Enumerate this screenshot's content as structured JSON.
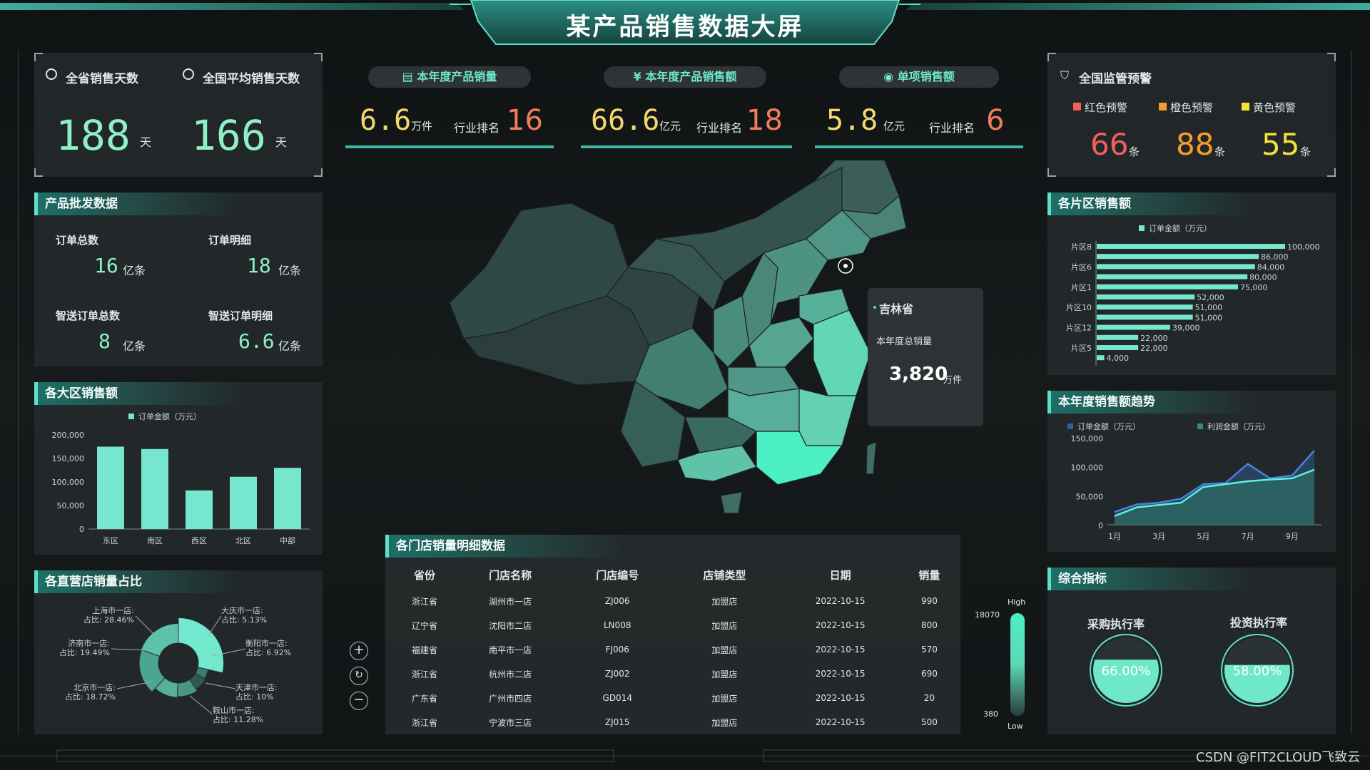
{
  "title": "某产品销售数据大屏",
  "days": {
    "province_label": "全省销售天数",
    "province_value": "188",
    "province_unit": "天",
    "national_label": "全国平均销售天数",
    "national_value": "166",
    "national_unit": "天"
  },
  "kpis": [
    {
      "label": "本年度产品销量",
      "value": "6.6",
      "unit": "万件",
      "rank_label": "行业排名",
      "rank": "16"
    },
    {
      "label": "本年度产品销售额",
      "value": "66.6",
      "unit": "亿元",
      "rank_label": "行业排名",
      "rank": "18"
    },
    {
      "label": "单项销售额",
      "value": "5.8",
      "unit": "亿元",
      "rank_label": "行业排名",
      "rank": "6"
    }
  ],
  "alerts": {
    "title": "全国监管预警",
    "items": [
      {
        "label": "红色预警",
        "value": "66",
        "unit": "条",
        "color": "#f0615c"
      },
      {
        "label": "橙色预警",
        "value": "88",
        "unit": "条",
        "color": "#f79b2c"
      },
      {
        "label": "黄色预警",
        "value": "55",
        "unit": "条",
        "color": "#f5e03c"
      }
    ]
  },
  "wholesale": {
    "title": "产品批发数据",
    "items": [
      {
        "label": "订单总数",
        "value": "16",
        "unit": "亿条"
      },
      {
        "label": "订单明细",
        "value": "18",
        "unit": "亿条"
      },
      {
        "label": "智送订单总数",
        "value": "8",
        "unit": "亿条"
      },
      {
        "label": "智送订单明细",
        "value": "6.6",
        "unit": "亿条"
      }
    ]
  },
  "region_chart": {
    "title": "各大区销售额",
    "legend": "订单金额（万元）",
    "y_ticks": [
      "200,000",
      "150,000",
      "100,000",
      "50,000",
      "0"
    ]
  },
  "store_share": {
    "title": "各直营店销量占比",
    "labels": [
      {
        "name": "上海市一店:",
        "share": "占比: 28.46%"
      },
      {
        "name": "大庆市一店:",
        "share": "占比: 5.13%"
      },
      {
        "name": "济南市一店:",
        "share": "占比: 19.49%"
      },
      {
        "name": "衡阳市一店:",
        "share": "占比: 6.92%"
      },
      {
        "name": "北京市一店:",
        "share": "占比: 18.72%"
      },
      {
        "name": "天津市一店:",
        "share": "占比: 10%"
      },
      {
        "name": "鞍山市一店:",
        "share": "占比: 11.28%"
      }
    ]
  },
  "map": {
    "tooltip_province": "吉林省",
    "tooltip_label": "本年度总销量",
    "tooltip_value": "3,820",
    "tooltip_unit": "万件",
    "legend_high": "High",
    "legend_low": "Low",
    "legend_max": "18070",
    "legend_min": "380"
  },
  "table": {
    "title": "各门店销量明细数据",
    "headers": [
      "省份",
      "门店名称",
      "门店编号",
      "店铺类型",
      "日期",
      "销量"
    ],
    "rows": [
      [
        "浙江省",
        "湖州市一店",
        "ZJ006",
        "加盟店",
        "2022-10-15",
        "990"
      ],
      [
        "辽宁省",
        "沈阳市二店",
        "LN008",
        "加盟店",
        "2022-10-15",
        "800"
      ],
      [
        "福建省",
        "南平市一店",
        "FJ006",
        "加盟店",
        "2022-10-15",
        "570"
      ],
      [
        "浙江省",
        "杭州市二店",
        "ZJ002",
        "加盟店",
        "2022-10-15",
        "690"
      ],
      [
        "广东省",
        "广州市四店",
        "GD014",
        "加盟店",
        "2022-10-15",
        "20"
      ],
      [
        "浙江省",
        "宁波市三店",
        "ZJ015",
        "加盟店",
        "2022-10-15",
        "500"
      ]
    ]
  },
  "zone_chart": {
    "title": "各片区销售额",
    "legend": "订单金额（万元）"
  },
  "trend_chart": {
    "title": "本年度销售额趋势",
    "legend_a": "订单金额（万元）",
    "legend_b": "利润金额（万元）",
    "y_ticks": [
      "150,000",
      "100,000",
      "50,000",
      "0"
    ]
  },
  "composite": {
    "title": "综合指标",
    "items": [
      {
        "label": "采购执行率",
        "value": "66.00%",
        "fraction": 0.66
      },
      {
        "label": "投资执行率",
        "value": "58.00%",
        "fraction": 0.58
      }
    ]
  },
  "watermark": "CSDN @FIT2CLOUD飞致云",
  "chart_data": [
    {
      "type": "bar",
      "title": "各大区销售额",
      "categories": [
        "东区",
        "南区",
        "西区",
        "北区",
        "中部"
      ],
      "series": [
        {
          "name": "订单金额（万元）",
          "values": [
            175000,
            170000,
            82000,
            111000,
            130000
          ]
        }
      ],
      "ylim": [
        0,
        200000
      ]
    },
    {
      "type": "bar",
      "title": "各片区销售额",
      "orientation": "horizontal",
      "categories": [
        "片区8",
        "",
        "片区6",
        "",
        "片区1",
        "",
        "片区10",
        "",
        "片区12",
        "",
        "片区5",
        ""
      ],
      "series": [
        {
          "name": "订单金额（万元）",
          "values": [
            100000,
            86000,
            84000,
            80000,
            75000,
            52000,
            51000,
            51000,
            39000,
            22000,
            22000,
            4000
          ]
        }
      ],
      "value_labels": [
        "100,000",
        "86,000",
        "84,000",
        "80,000",
        "75,000",
        "52,000",
        "51,000",
        "51,000",
        "39,000",
        "22,000",
        "22,000",
        "4,000"
      ]
    },
    {
      "type": "area",
      "title": "本年度销售额趋势",
      "x": [
        "1月",
        "2月",
        "3月",
        "4月",
        "5月",
        "6月",
        "7月",
        "8月",
        "9月",
        "10月"
      ],
      "x_tick_labels": [
        "1月",
        "3月",
        "5月",
        "7月",
        "9月"
      ],
      "series": [
        {
          "name": "订单金额（万元）",
          "values": [
            22000,
            35000,
            38000,
            45000,
            70000,
            72000,
            105000,
            80000,
            85000,
            128000
          ]
        },
        {
          "name": "利润金额（万元）",
          "values": [
            15000,
            30000,
            34000,
            38000,
            65000,
            70000,
            75000,
            78000,
            80000,
            95000
          ]
        }
      ],
      "ylim": [
        0,
        150000
      ]
    },
    {
      "type": "pie",
      "title": "各直营店销量占比",
      "categories": [
        "上海市一店",
        "大庆市一店",
        "衡阳市一店",
        "天津市一店",
        "鞍山市一店",
        "北京市一店",
        "济南市一店"
      ],
      "values": [
        28.46,
        5.13,
        6.92,
        10,
        11.28,
        18.72,
        19.49
      ]
    }
  ]
}
